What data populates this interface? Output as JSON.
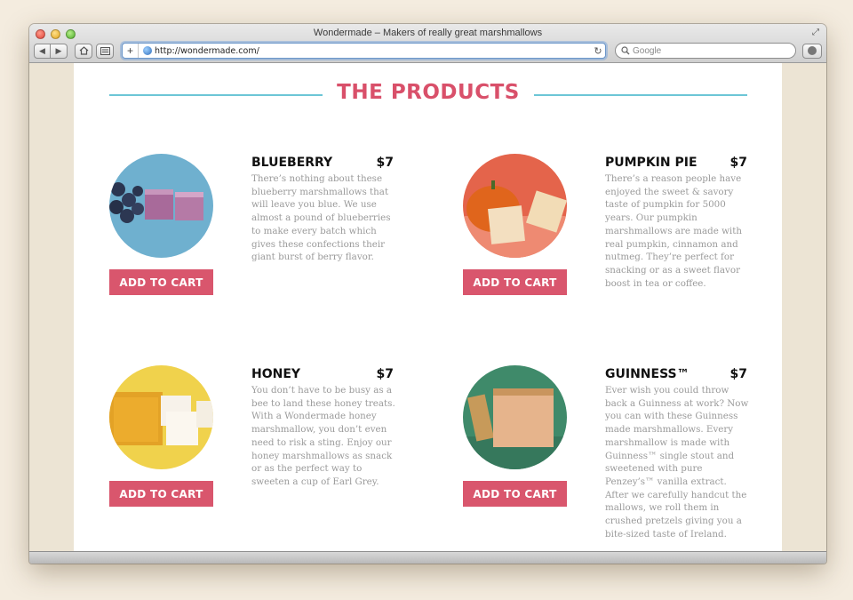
{
  "window": {
    "title": "Wondermade – Makers of really great marshmallows"
  },
  "toolbar": {
    "back_icon": "back-arrow-icon",
    "forward_icon": "forward-arrow-icon",
    "home_icon": "home-icon",
    "new_tab_plus": "+",
    "url": "http://wondermade.com/",
    "reload_symbol": "↻",
    "search_placeholder": "Google"
  },
  "page": {
    "section_title": "THE PRODUCTS",
    "products": [
      {
        "name": "BLUEBERRY",
        "price": "$7",
        "description": "There’s nothing about these blueberry marshmallows that will leave you blue. We use almost a pound of blueberries to make every batch which gives these confections their giant burst of berry flavor.",
        "button": "ADD TO CART",
        "image_color": "#6fb0cf"
      },
      {
        "name": "PUMPKIN PIE",
        "price": "$7",
        "description": "There’s a reason people have enjoyed the sweet & savory taste of pumpkin for 5000 years. Our pumpkin marshmallows are made with real pumpkin, cinnamon and nutmeg. They’re perfect for snacking or as a sweet flavor boost in tea or coffee.",
        "button": "ADD TO CART",
        "image_color": "#e4644b"
      },
      {
        "name": "HONEY",
        "price": "$7",
        "description": "You don’t have to be busy as a bee to land these honey treats. With a Wondermade honey marshmallow, you don’t even need to risk a sting. Enjoy our honey marshmallows as snack or as the perfect way to sweeten a cup of Earl Grey.",
        "button": "ADD TO CART",
        "image_color": "#f0d24c"
      },
      {
        "name": "GUINNESS™",
        "price": "$7",
        "description": "Ever wish you could throw back a Guinness at work? Now you can with these Guinness made marshmallows. Every marshmallow is made with Guinness™ single stout and sweetened with pure Penzey’s™ vanilla extract. After we carefully handcut the mallows, we roll them in crushed pretzels giving you a bite-sized taste of Ireland.",
        "button": "ADD TO CART",
        "image_color": "#3f8a6a"
      }
    ]
  },
  "colors": {
    "accent": "#d9566d",
    "rule": "#6cc6d6",
    "desc_text": "#9a9a9a",
    "backdrop": "#f4ecdf"
  }
}
